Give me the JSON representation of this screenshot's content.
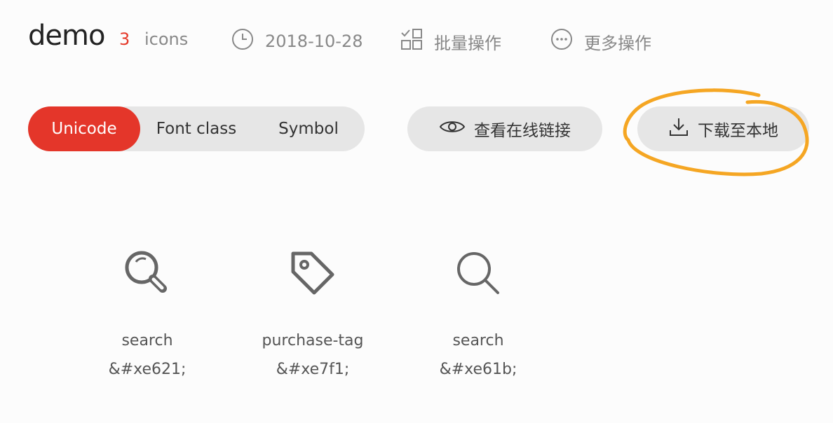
{
  "header": {
    "project_name": "demo",
    "icon_count": "3",
    "icon_unit": "icons",
    "date": "2018-10-28",
    "batch_label": "批量操作",
    "more_label": "更多操作"
  },
  "tabs": [
    {
      "label": "Unicode",
      "active": true
    },
    {
      "label": "Font class",
      "active": false
    },
    {
      "label": "Symbol",
      "active": false
    }
  ],
  "actions": {
    "view_online_label": "查看在线链接",
    "download_label": "下载至本地"
  },
  "icons": [
    {
      "name": "search",
      "code": "&#xe621;",
      "icon": "search-thick-icon"
    },
    {
      "name": "purchase-tag",
      "code": "&#xe7f1;",
      "icon": "tag-icon"
    },
    {
      "name": "search",
      "code": "&#xe61b;",
      "icon": "search-thin-icon"
    }
  ],
  "colors": {
    "accent": "#e4362a",
    "pill_bg": "#e6e6e6",
    "annotation": "#f5a623"
  }
}
